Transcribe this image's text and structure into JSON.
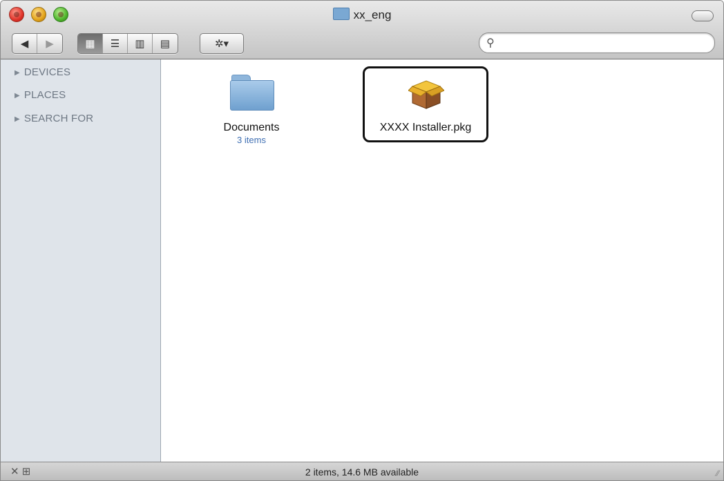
{
  "window": {
    "title": "xx_eng"
  },
  "toolbar": {
    "nav": [
      "◀",
      "▶"
    ],
    "views": [
      "▦",
      "☰",
      "▥",
      "▤"
    ],
    "action": "✲▾"
  },
  "search": {
    "value": "",
    "glyph": "⚲"
  },
  "sidebar": {
    "sections": [
      {
        "label": "DEVICES"
      },
      {
        "label": "PLACES"
      },
      {
        "label": "SEARCH FOR"
      }
    ]
  },
  "files": [
    {
      "name": "Documents",
      "subtitle": "3 items",
      "icon": "folder-icon"
    },
    {
      "name": "XXXX Installer.pkg",
      "icon": "package-icon",
      "selected": true
    }
  ],
  "status": {
    "text": "2 items, 14.6 MB available"
  },
  "colors": {
    "accent": "#3f6fb3",
    "sidebar": "#dfe4ea"
  }
}
